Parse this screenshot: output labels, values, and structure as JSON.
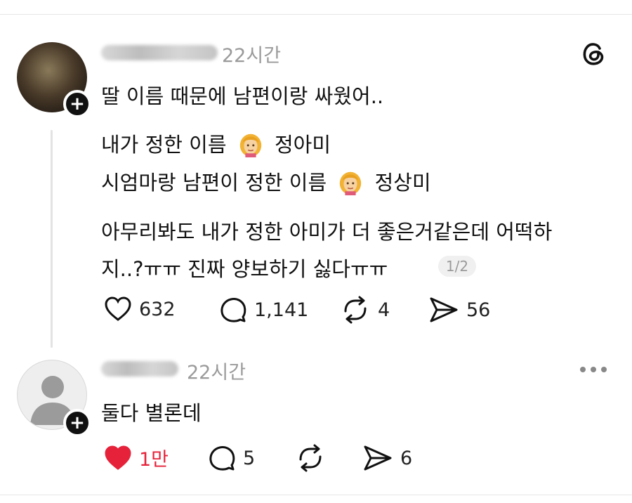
{
  "post": {
    "time": "22시간",
    "lines": [
      "딸 이름 때문에 남편이랑 싸웠어..",
      "내가 정한 이름",
      "정아미",
      "시엄마랑 남편이 정한 이름",
      "정상미",
      "아무리봐도 내가 정한 아미가 더 좋은거같은데 어떡하",
      "지..?ㅠㅠ 진짜 양보하기 싫다ㅠㅠ"
    ],
    "page_indicator": "1/2",
    "likes": "632",
    "comments": "1,141",
    "reposts": "4",
    "shares": "56"
  },
  "reply": {
    "time": "22시간",
    "text": "둘다 별론데",
    "likes": "1만",
    "comments": "5",
    "shares": "6"
  },
  "icons": {
    "brand": "threads-icon",
    "like": "heart-icon",
    "comment": "comment-bubble-icon",
    "repost": "repost-icon",
    "share": "send-icon",
    "more": "more-dots-icon",
    "follow": "plus-icon",
    "emoji": "woman-emoji-icon"
  },
  "colors": {
    "liked_heart": "#e5223a",
    "muted_text": "#9a9a9a"
  }
}
